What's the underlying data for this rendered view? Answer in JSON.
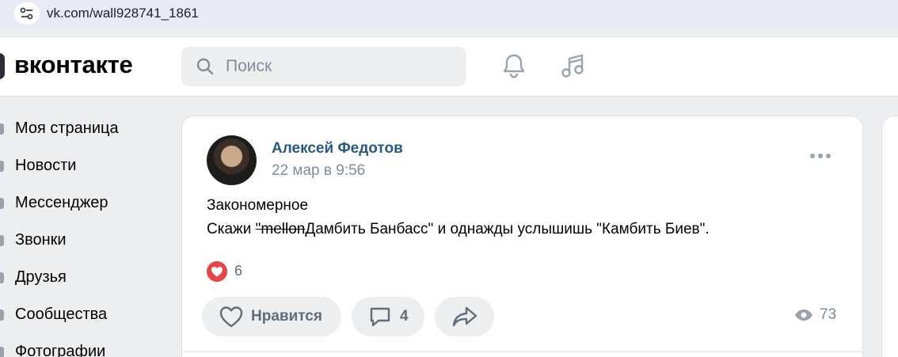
{
  "browser": {
    "url": "vk.com/wall928741_1861"
  },
  "header": {
    "logo": "вконтакте",
    "search_placeholder": "Поиск"
  },
  "sidebar": {
    "items": [
      {
        "label": "Моя страница"
      },
      {
        "label": "Новости"
      },
      {
        "label": "Мессенджер"
      },
      {
        "label": "Звонки"
      },
      {
        "label": "Друзья"
      },
      {
        "label": "Сообщества"
      },
      {
        "label": "Фотографии"
      }
    ]
  },
  "post": {
    "author": "Алексей Федотов",
    "date": "22 мар в 9:56",
    "text_line1": "Закономерное",
    "text_line2_pre": "Скажи ",
    "text_line2_strike": "\"mellon",
    "text_line2_post": "Дамбить Банбасс\" и однажды услышишь \"Камбить Биев\".",
    "reactions_count": "6",
    "like_label": "Нравится",
    "comments_count": "4",
    "views_count": "73"
  },
  "colors": {
    "accent": "#2a5885",
    "like_red": "#e64646",
    "bg": "#edeef0"
  }
}
